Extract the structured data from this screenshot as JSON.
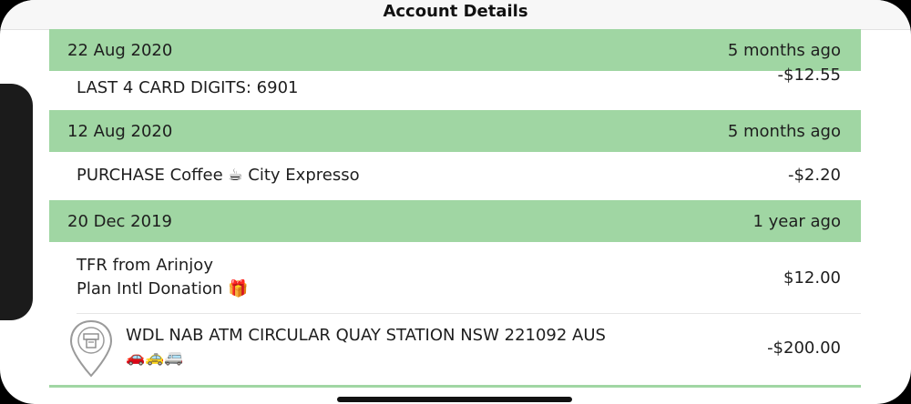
{
  "nav": {
    "title": "Account Details"
  },
  "sections": [
    {
      "date": "22 Aug 2020",
      "ago": "5 months ago",
      "rows": [
        {
          "desc": "LAST 4 CARD DIGITS: 6901",
          "amount": "-$12.55"
        }
      ]
    },
    {
      "date": "12 Aug 2020",
      "ago": "5 months ago",
      "rows": [
        {
          "desc": "PURCHASE Coffee ☕ City Expresso",
          "amount": "-$2.20"
        }
      ]
    },
    {
      "date": "20 Dec 2019",
      "ago": "1 year ago",
      "rows": [
        {
          "desc_line1": "TFR from Arinjoy",
          "desc_line2": "Plan Intl Donation 🎁",
          "amount": "$12.00"
        },
        {
          "desc_line1": "WDL NAB ATM CIRCULAR QUAY STATION NSW 221092 AUS",
          "desc_line2": "🚗🚕🚐",
          "amount": "-$200.00",
          "icon": "atm-location-icon"
        }
      ]
    }
  ],
  "colors": {
    "section_bg": "#a0d6a3",
    "text": "#1e1e1e"
  }
}
